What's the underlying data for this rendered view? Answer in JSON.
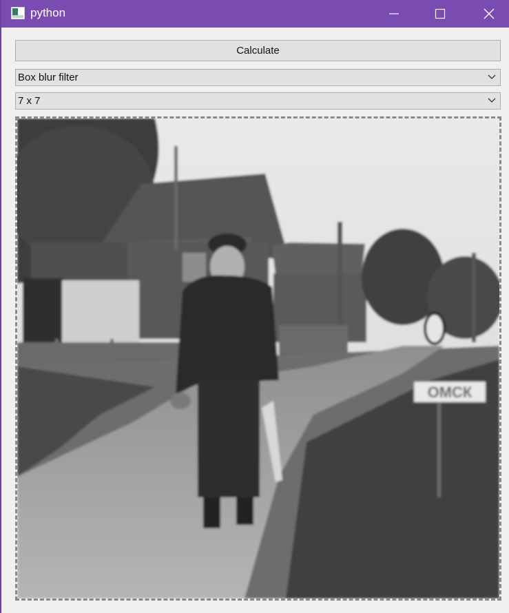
{
  "window": {
    "title": "python"
  },
  "toolbar": {
    "calculate_label": "Calculate"
  },
  "filter_select": {
    "selected": "Box blur filter"
  },
  "kernel_select": {
    "selected": "7 x 7"
  },
  "image": {
    "sign_text": "ОМСК",
    "blur": "box blur 7x7"
  }
}
